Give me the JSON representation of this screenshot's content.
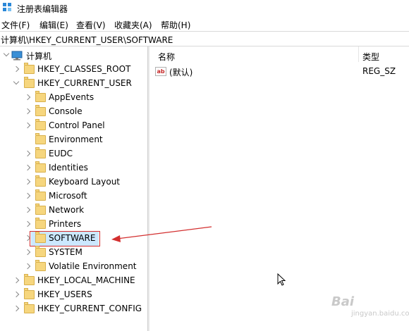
{
  "window": {
    "title": "注册表编辑器"
  },
  "menu": [
    {
      "label": "文件(F)"
    },
    {
      "label": "编辑(E)"
    },
    {
      "label": "查看(V)"
    },
    {
      "label": "收藏夹(A)"
    },
    {
      "label": "帮助(H)"
    }
  ],
  "address": {
    "path": "计算机\\HKEY_CURRENT_USER\\SOFTWARE"
  },
  "tree": {
    "root": "计算机",
    "hives": [
      {
        "label": "HKEY_CLASSES_ROOT"
      },
      {
        "label": "HKEY_CURRENT_USER"
      },
      {
        "label": "HKEY_LOCAL_MACHINE"
      },
      {
        "label": "HKEY_USERS"
      },
      {
        "label": "HKEY_CURRENT_CONFIG"
      }
    ],
    "hkcu_children": [
      {
        "label": "AppEvents"
      },
      {
        "label": "Console"
      },
      {
        "label": "Control Panel"
      },
      {
        "label": "Environment"
      },
      {
        "label": "EUDC"
      },
      {
        "label": "Identities"
      },
      {
        "label": "Keyboard Layout"
      },
      {
        "label": "Microsoft"
      },
      {
        "label": "Network"
      },
      {
        "label": "Printers"
      },
      {
        "label": "SOFTWARE"
      },
      {
        "label": "SYSTEM"
      },
      {
        "label": "Volatile Environment"
      }
    ]
  },
  "list": {
    "columns": {
      "name": "名称",
      "type": "类型"
    },
    "rows": [
      {
        "name": "(默认)",
        "type": "REG_SZ",
        "icon": "string-value-icon"
      }
    ]
  },
  "watermark": {
    "text": "Bai",
    "sub": "jingyan.baidu.com"
  },
  "colors": {
    "selection": "#cce8ff",
    "annotation": "#d32f2f",
    "folder": "#f6d67e"
  }
}
